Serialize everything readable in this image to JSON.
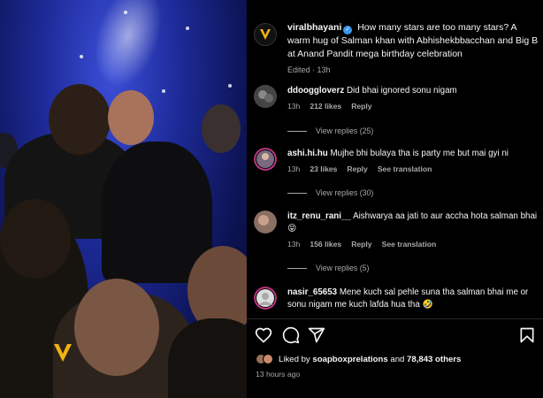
{
  "post": {
    "username": "viralbhayani",
    "caption": "How many stars are too many stars? A warm hug of Salman khan with Abhishekbbacchan and Big B at Anand Pandit mega birthday celebration",
    "edited": "Edited",
    "edited_time": "13h"
  },
  "comments": [
    {
      "username": "ddooggloverz",
      "text": "Did bhai ignored sonu nigam",
      "time": "13h",
      "likes": "212 likes",
      "reply": "Reply",
      "translate": "",
      "view_replies": "View replies (25)"
    },
    {
      "username": "ashi.hi.hu",
      "text": "Mujhe bhi bulaya tha is party me but mai gyi ni",
      "time": "13h",
      "likes": "23 likes",
      "reply": "Reply",
      "translate": "See translation",
      "view_replies": "View replies (30)"
    },
    {
      "username": "itz_renu_rani__",
      "text": "Aishwarya aa jati to aur accha hota salman bhai 😝",
      "time": "13h",
      "likes": "156 likes",
      "reply": "Reply",
      "translate": "See translation",
      "view_replies": "View replies (5)"
    },
    {
      "username": "nasir_65653",
      "text": "Mene kuch sal pehle suna tha salman bhai me or sonu nigam me kuch lafda hua tha 🤣",
      "time": "",
      "likes": "",
      "reply": "",
      "translate": "",
      "view_replies": ""
    }
  ],
  "likes": {
    "prefix": "Liked by ",
    "by_user": "soapboxprelations",
    "and": " and ",
    "count": "78,843 others"
  },
  "time_ago": "13 hours ago",
  "icons": {
    "like": "heart-icon",
    "comment": "comment-icon",
    "share": "share-icon",
    "save": "bookmark-icon"
  },
  "colors": {
    "background": "#000000",
    "verified": "#3897f0",
    "muted": "#a8a8a8"
  }
}
